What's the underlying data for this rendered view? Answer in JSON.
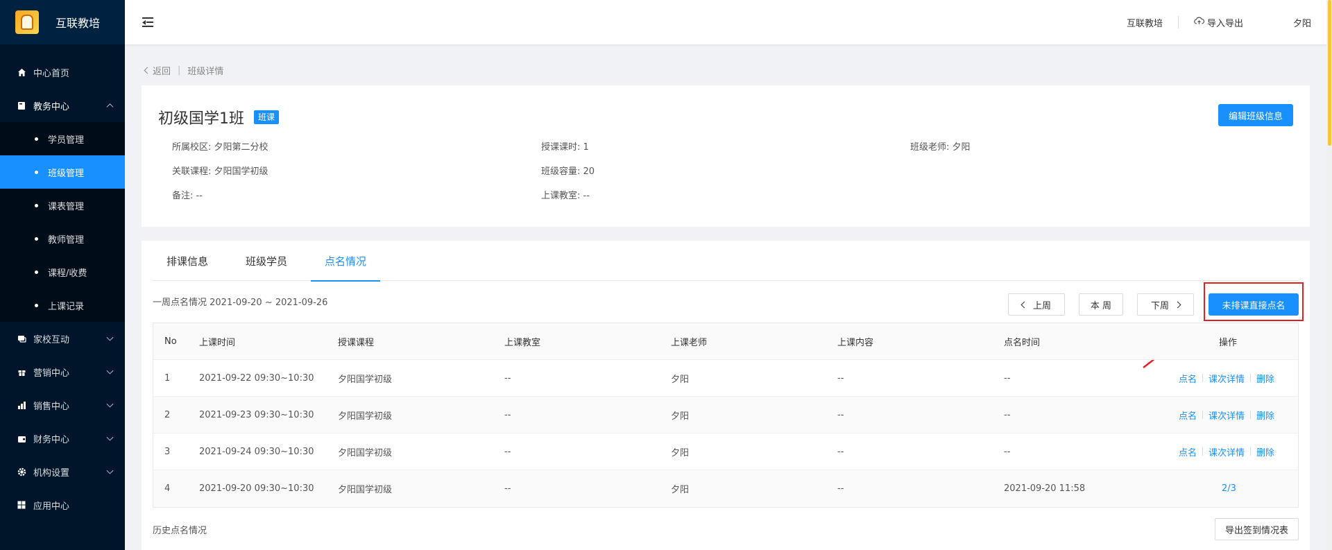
{
  "app": {
    "title": "互联教培"
  },
  "sidebar": {
    "items": [
      {
        "label": "中心首页",
        "icon": "home-icon"
      },
      {
        "label": "教务中心",
        "icon": "book-icon",
        "expanded": true,
        "children": [
          {
            "label": "学员管理"
          },
          {
            "label": "班级管理",
            "active": true
          },
          {
            "label": "课表管理"
          },
          {
            "label": "教师管理"
          },
          {
            "label": "课程/收费"
          },
          {
            "label": "上课记录"
          }
        ]
      },
      {
        "label": "家校互动",
        "icon": "chat-icon"
      },
      {
        "label": "营销中心",
        "icon": "gift-icon"
      },
      {
        "label": "销售中心",
        "icon": "bar-chart-icon"
      },
      {
        "label": "财务中心",
        "icon": "wallet-icon"
      },
      {
        "label": "机构设置",
        "icon": "gear-icon"
      },
      {
        "label": "应用中心",
        "icon": "grid-icon"
      }
    ]
  },
  "header": {
    "org": "互联教培",
    "import_export": "导入导出",
    "user": "夕阳"
  },
  "breadcrumb": {
    "back": "返回",
    "current": "班级详情"
  },
  "class_info": {
    "name": "初级国学1班",
    "badge": "班课",
    "edit_button": "编辑班级信息",
    "fields": {
      "campus": "所属校区: 夕阳第二分校",
      "hours": "授课课时: 1",
      "teacher": "班级老师: 夕阳",
      "course": "关联课程: 夕阳国学初级",
      "capacity": "班级容量: 20",
      "remark": "备注: --",
      "room": "上课教室: --"
    }
  },
  "tabs": [
    "排课信息",
    "班级学员",
    "点名情况"
  ],
  "active_tab": 2,
  "week": {
    "range": "一周点名情况 2021-09-20 ~ 2021-09-26",
    "prev": "上周",
    "this": "本 周",
    "next": "下周",
    "direct_rollcall": "未排课直接点名"
  },
  "table": {
    "columns": [
      "No",
      "上课时间",
      "授课课程",
      "上课教室",
      "上课老师",
      "上课内容",
      "点名时间",
      "操作"
    ],
    "rows": [
      {
        "no": "1",
        "time": "2021-09-22 09:30~10:30",
        "course": "夕阳国学初级",
        "room": "--",
        "teacher": "夕阳",
        "content": "--",
        "rollcall_time": "--",
        "ops": [
          "点名",
          "课次详情",
          "删除"
        ]
      },
      {
        "no": "2",
        "time": "2021-09-23 09:30~10:30",
        "course": "夕阳国学初级",
        "room": "--",
        "teacher": "夕阳",
        "content": "--",
        "rollcall_time": "--",
        "ops": [
          "点名",
          "课次详情",
          "删除"
        ]
      },
      {
        "no": "3",
        "time": "2021-09-24 09:30~10:30",
        "course": "夕阳国学初级",
        "room": "--",
        "teacher": "夕阳",
        "content": "--",
        "rollcall_time": "--",
        "ops": [
          "点名",
          "课次详情",
          "删除"
        ]
      },
      {
        "no": "4",
        "time": "2021-09-20 09:30~10:30",
        "course": "夕阳国学初级",
        "room": "--",
        "teacher": "夕阳",
        "content": "--",
        "rollcall_time": "2021-09-20 11:58",
        "ops": [
          "2/3"
        ]
      }
    ]
  },
  "history": {
    "label": "历史点名情况",
    "export_button": "导出签到情况表"
  },
  "colors": {
    "primary": "#1890ff",
    "sidebar": "#001529",
    "highlight": "#e02020"
  }
}
